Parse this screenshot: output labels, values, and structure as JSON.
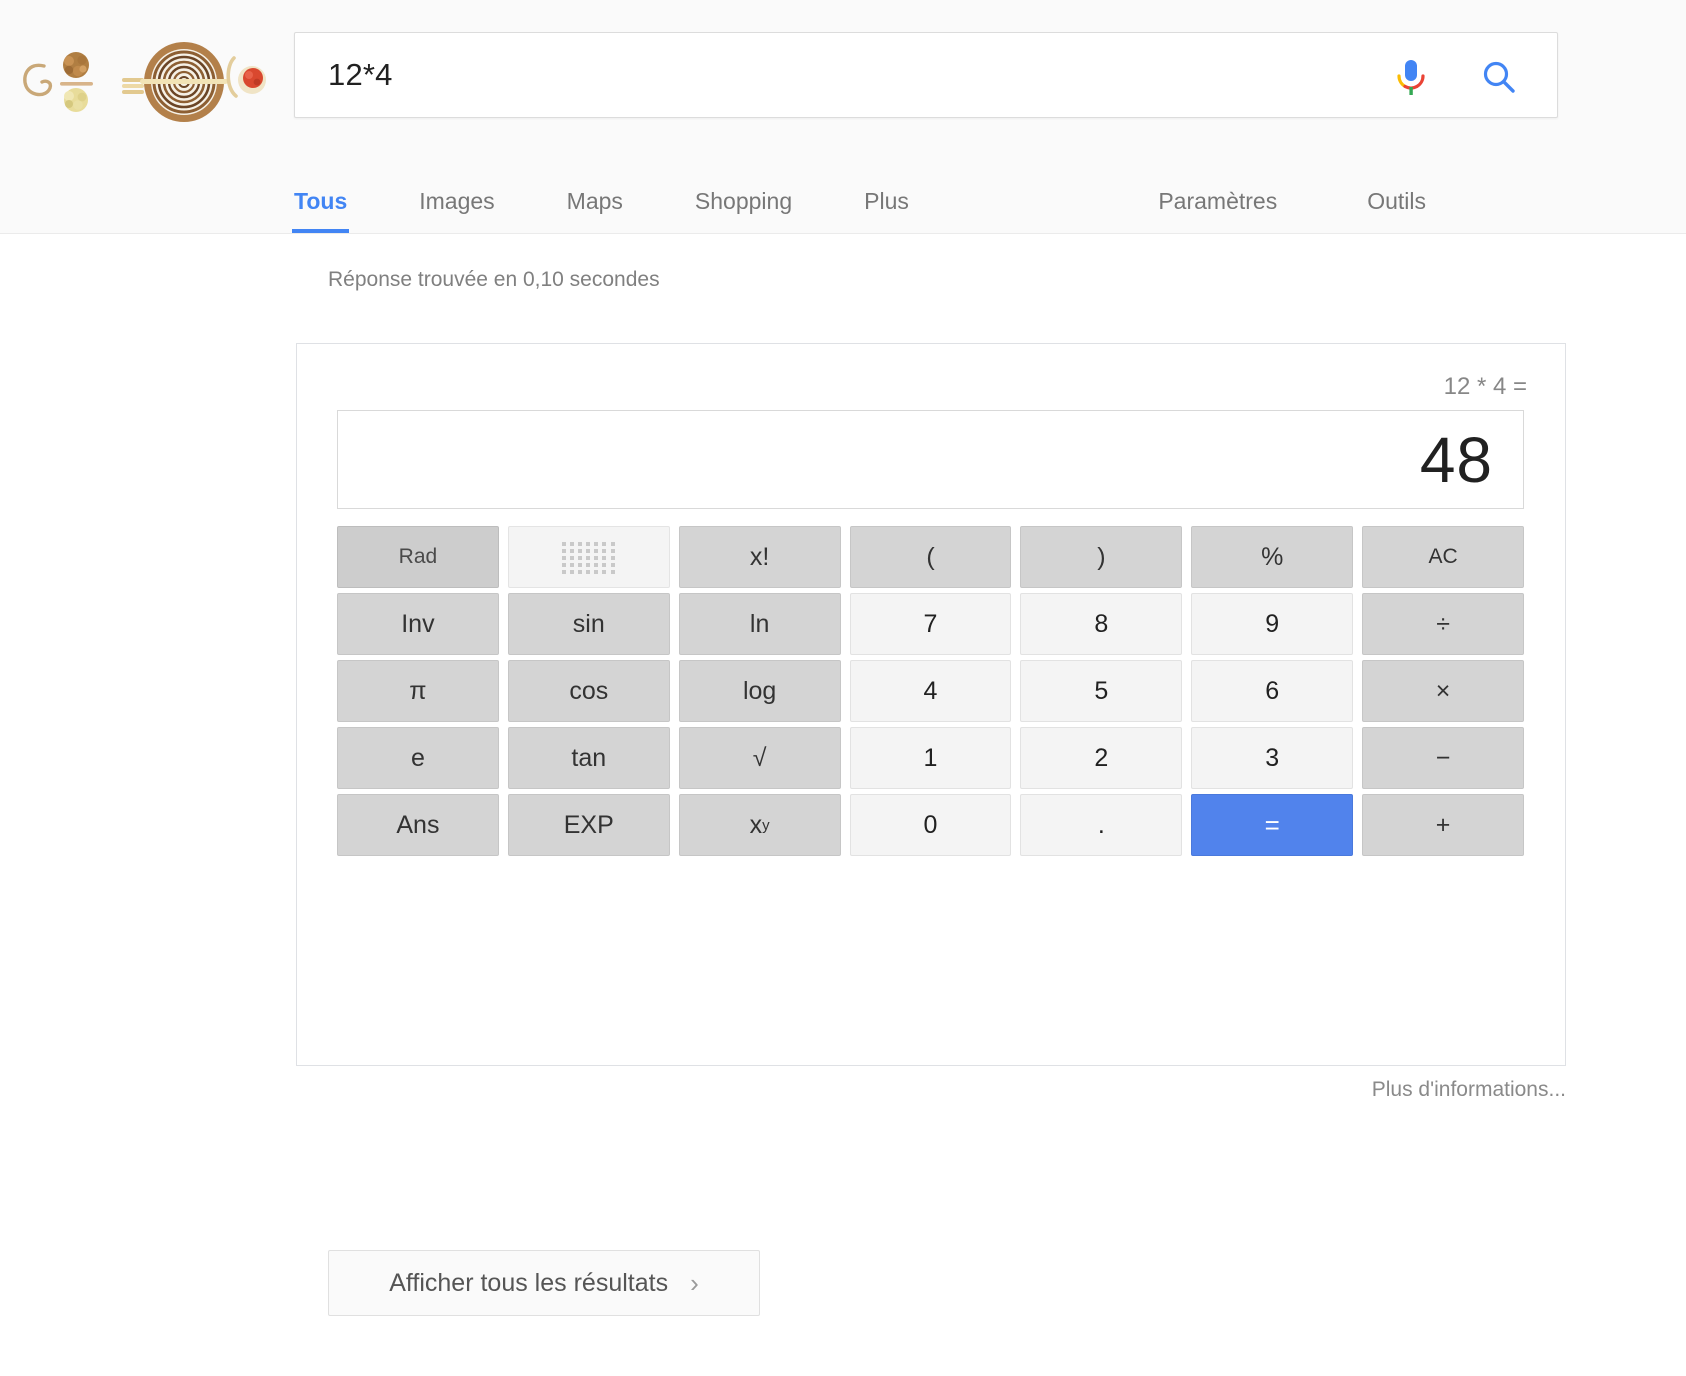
{
  "browser": {
    "logo_alt": "google-food-doodle"
  },
  "search": {
    "query": "12*4",
    "placeholder": "",
    "mic_icon": "microphone-icon",
    "search_icon": "search-magnifier-icon"
  },
  "nav": {
    "left_items": [
      {
        "label": "Tous",
        "active": true
      },
      {
        "label": "Images",
        "active": false
      },
      {
        "label": "Maps",
        "active": false
      },
      {
        "label": "Shopping",
        "active": false
      },
      {
        "label": "Plus",
        "active": false
      }
    ],
    "right_items": [
      {
        "label": "Paramètres"
      },
      {
        "label": "Outils"
      }
    ]
  },
  "results": {
    "stats": "Réponse trouvée en 0,10 secondes",
    "more_info": "Plus d'informations...",
    "show_all": "Afficher tous les résultats",
    "show_all_chevron": "chevron-right-icon"
  },
  "calculator": {
    "expression": "12 * 4 =",
    "result": "48",
    "accent_color": "#5183ec",
    "keys": [
      {
        "label": "Rad",
        "name": "calc-key-rad",
        "style": "mode"
      },
      {
        "label": "",
        "name": "calc-key-keypad",
        "style": "keypad",
        "icon": "keypad-dots-icon"
      },
      {
        "label": "x!",
        "name": "calc-key-factorial",
        "style": "dark"
      },
      {
        "label": "(",
        "name": "calc-key-open-paren",
        "style": "dark"
      },
      {
        "label": ")",
        "name": "calc-key-close-paren",
        "style": "dark"
      },
      {
        "label": "%",
        "name": "calc-key-percent",
        "style": "dark"
      },
      {
        "label": "AC",
        "name": "calc-key-ac",
        "style": "dark",
        "small": true
      },
      {
        "label": "Inv",
        "name": "calc-key-inv",
        "style": "dark"
      },
      {
        "label": "sin",
        "name": "calc-key-sin",
        "style": "dark"
      },
      {
        "label": "ln",
        "name": "calc-key-ln",
        "style": "dark"
      },
      {
        "label": "7",
        "name": "calc-key-7",
        "style": "light"
      },
      {
        "label": "8",
        "name": "calc-key-8",
        "style": "light"
      },
      {
        "label": "9",
        "name": "calc-key-9",
        "style": "light"
      },
      {
        "label": "÷",
        "name": "calc-key-divide",
        "style": "dark"
      },
      {
        "label": "π",
        "name": "calc-key-pi",
        "style": "dark"
      },
      {
        "label": "cos",
        "name": "calc-key-cos",
        "style": "dark"
      },
      {
        "label": "log",
        "name": "calc-key-log",
        "style": "dark"
      },
      {
        "label": "4",
        "name": "calc-key-4",
        "style": "light"
      },
      {
        "label": "5",
        "name": "calc-key-5",
        "style": "light"
      },
      {
        "label": "6",
        "name": "calc-key-6",
        "style": "light"
      },
      {
        "label": "×",
        "name": "calc-key-multiply",
        "style": "dark"
      },
      {
        "label": "e",
        "name": "calc-key-e",
        "style": "dark"
      },
      {
        "label": "tan",
        "name": "calc-key-tan",
        "style": "dark"
      },
      {
        "label": "√",
        "name": "calc-key-sqrt",
        "style": "dark"
      },
      {
        "label": "1",
        "name": "calc-key-1",
        "style": "light"
      },
      {
        "label": "2",
        "name": "calc-key-2",
        "style": "light"
      },
      {
        "label": "3",
        "name": "calc-key-3",
        "style": "light"
      },
      {
        "label": "−",
        "name": "calc-key-minus",
        "style": "dark"
      },
      {
        "label": "Ans",
        "name": "calc-key-ans",
        "style": "dark"
      },
      {
        "label": "EXP",
        "name": "calc-key-exp",
        "style": "dark"
      },
      {
        "label": "x^y",
        "name": "calc-key-power",
        "style": "dark",
        "sup": "y",
        "base": "x"
      },
      {
        "label": "0",
        "name": "calc-key-0",
        "style": "light"
      },
      {
        "label": ".",
        "name": "calc-key-decimal",
        "style": "light"
      },
      {
        "label": "=",
        "name": "calc-key-equals",
        "style": "equals"
      },
      {
        "label": "+",
        "name": "calc-key-plus",
        "style": "dark"
      }
    ]
  }
}
